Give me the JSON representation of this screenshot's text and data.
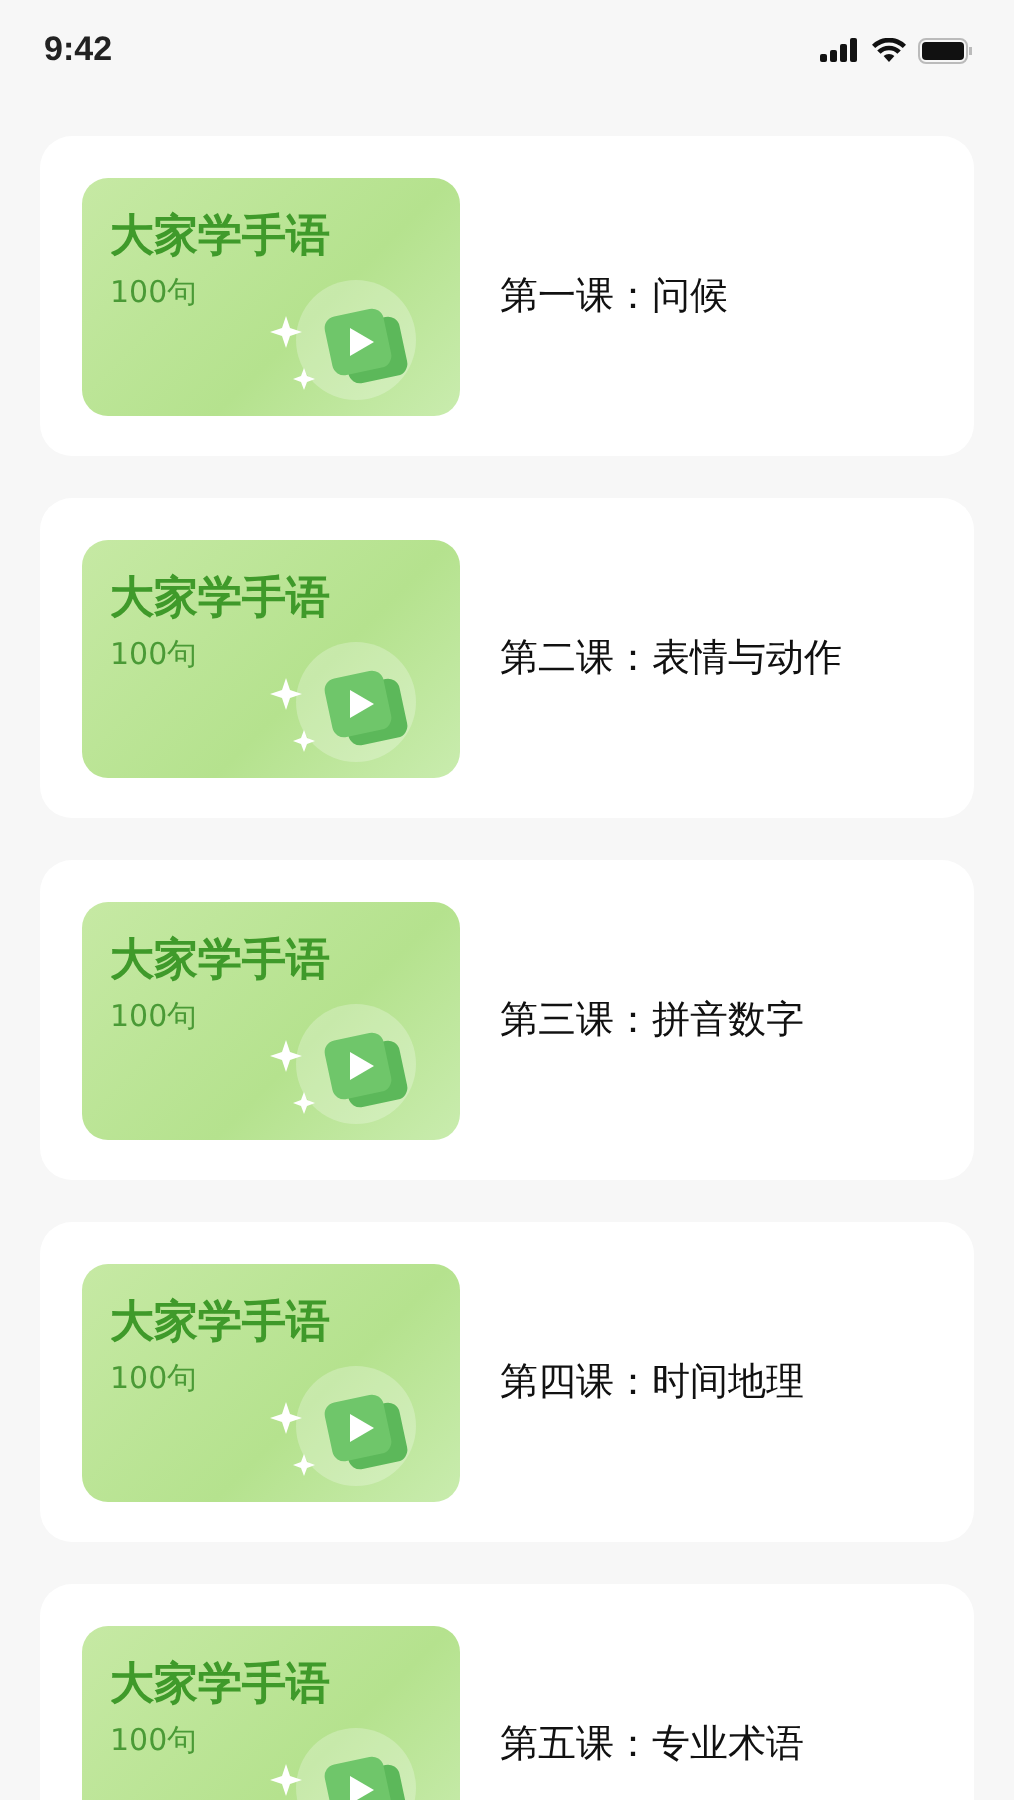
{
  "status_bar": {
    "time": "9:42"
  },
  "lessons": [
    {
      "cover_title": "大家学手语",
      "cover_count": "100句",
      "title": "第一课：问候"
    },
    {
      "cover_title": "大家学手语",
      "cover_count": "100句",
      "title": "第二课：表情与动作"
    },
    {
      "cover_title": "大家学手语",
      "cover_count": "100句",
      "title": "第三课：拼音数字"
    },
    {
      "cover_title": "大家学手语",
      "cover_count": "100句",
      "title": "第四课：时间地理"
    },
    {
      "cover_title": "大家学手语",
      "cover_count": "100句",
      "title": "第五课：专业术语"
    }
  ]
}
